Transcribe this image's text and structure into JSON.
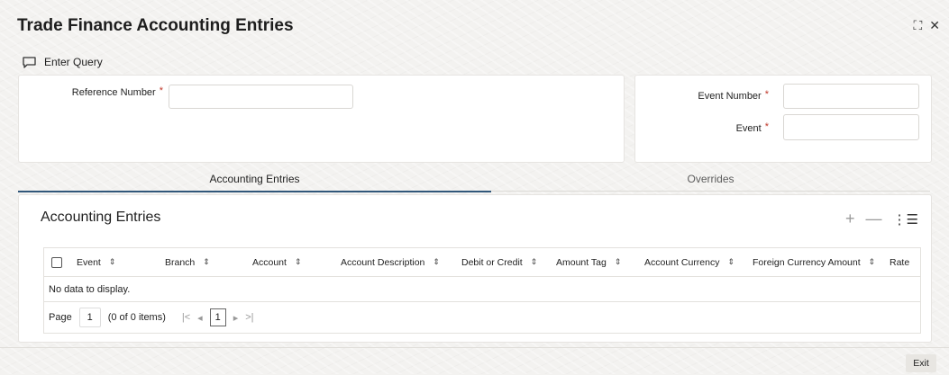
{
  "window": {
    "title": "Trade Finance Accounting Entries",
    "controls": {
      "maximize_glyph": "⛶",
      "close_glyph": "✕"
    }
  },
  "toolbar": {
    "enter_query_label": "Enter Query"
  },
  "form": {
    "reference_number": {
      "label": "Reference Number",
      "required": "*",
      "value": ""
    },
    "event_number": {
      "label": "Event Number",
      "required": "*",
      "value": ""
    },
    "event": {
      "label": "Event",
      "required": "*",
      "value": ""
    }
  },
  "tabs": [
    {
      "label": "Accounting Entries",
      "active": true
    },
    {
      "label": "Overrides",
      "active": false
    }
  ],
  "grid": {
    "title": "Accounting Entries",
    "tools": {
      "add": "+",
      "remove": "—",
      "columns": "⋮☰"
    },
    "columns": [
      "Event",
      "Branch",
      "Account",
      "Account Description",
      "Debit or Credit",
      "Amount Tag",
      "Account Currency",
      "Foreign Currency Amount",
      "Rate"
    ],
    "empty_text": "No data to display.",
    "pager": {
      "page_label": "Page",
      "page_value": "1",
      "items_text": "(0 of 0 items)",
      "first": "|<",
      "prev": "◂",
      "current": "1",
      "next": "▸",
      "last": ">|"
    }
  },
  "footer": {
    "exit_label": "Exit"
  },
  "colors": {
    "accent": "#31577a",
    "required": "#c0392b"
  }
}
